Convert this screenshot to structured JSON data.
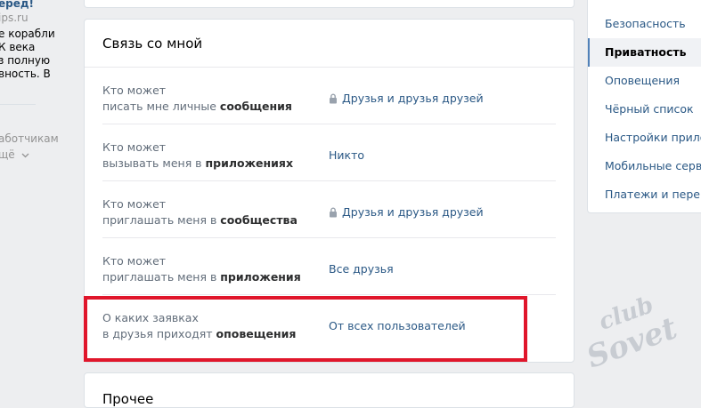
{
  "left_column": {
    "ad_title": "еред!",
    "ad_site": "ips.ru",
    "ad_lines": [
      "е корабли",
      "К века",
      "з полную",
      "вность. В"
    ],
    "developers_text": "аботчикам",
    "more_text": "щё"
  },
  "privacy_section": {
    "title": "Связь со мной",
    "rows": [
      {
        "line1": "Кто может",
        "line2_prefix": "писать мне личные ",
        "line2_bold": "сообщения",
        "value": "Друзья и друзья друзей",
        "locked": true
      },
      {
        "line1": "Кто может",
        "line2_prefix": "вызывать меня в ",
        "line2_bold": "приложениях",
        "value": "Никто",
        "locked": false
      },
      {
        "line1": "Кто может",
        "line2_prefix": "приглашать меня в ",
        "line2_bold": "сообщества",
        "value": "Друзья и друзья друзей",
        "locked": true
      },
      {
        "line1": "Кто может",
        "line2_prefix": "приглашать меня в ",
        "line2_bold": "приложения",
        "value": "Все друзья",
        "locked": false
      },
      {
        "line1": "О каких заявках",
        "line2_prefix": "в друзья приходят ",
        "line2_bold": "оповещения",
        "value": "От всех пользователей",
        "locked": false
      }
    ]
  },
  "next_section": {
    "title": "Прочее"
  },
  "settings_menu": {
    "items": [
      {
        "label": "Безопасность",
        "active": false
      },
      {
        "label": "Приватность",
        "active": true
      },
      {
        "label": "Оповещения",
        "active": false
      },
      {
        "label": "Чёрный список",
        "active": false
      },
      {
        "label": "Настройки прило",
        "active": false
      },
      {
        "label": "Мобильные серви",
        "active": false
      },
      {
        "label": "Платежи и перево",
        "active": false
      }
    ]
  },
  "watermark": {
    "line1": "club",
    "line2": "Sovet"
  },
  "colors": {
    "accent": "#2a5885",
    "highlight_border": "#e0162b",
    "active_marker": "#5181b8"
  },
  "icons": {
    "lock": "lock-icon",
    "chevron": "chevron-down-icon"
  }
}
